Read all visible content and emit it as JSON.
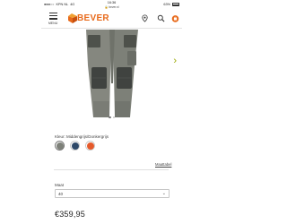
{
  "statusbar": {
    "carrier": "KPN NL",
    "network": "4G",
    "time": "16:36",
    "url": "bever.nl",
    "battery": "63%"
  },
  "header": {
    "menu_label": "MENU",
    "logo_text": "BEVER",
    "icons": [
      "hamburger-menu-icon",
      "location-pin-icon",
      "search-icon",
      "shopping-bag-icon"
    ],
    "brand_color": "#e86a1b"
  },
  "gallery": {
    "image": "grey work trousers with dark knee pads",
    "next_arrow": "›",
    "slide_count": 2,
    "active_slide": 1
  },
  "product": {
    "color_label": "Kleur: Middengrijs/Donkergrijs",
    "swatches": [
      {
        "name": "Middengrijs/Donkergrijs",
        "color": "#7d8079",
        "selected": true
      },
      {
        "name": "blue",
        "color": "#2d4868",
        "selected": false
      },
      {
        "name": "orange",
        "color": "#e55a2b",
        "selected": false
      }
    ],
    "size_chart_link": "Maattabel",
    "size_label": "Maat",
    "size_value": "40",
    "price": "€359,95"
  }
}
